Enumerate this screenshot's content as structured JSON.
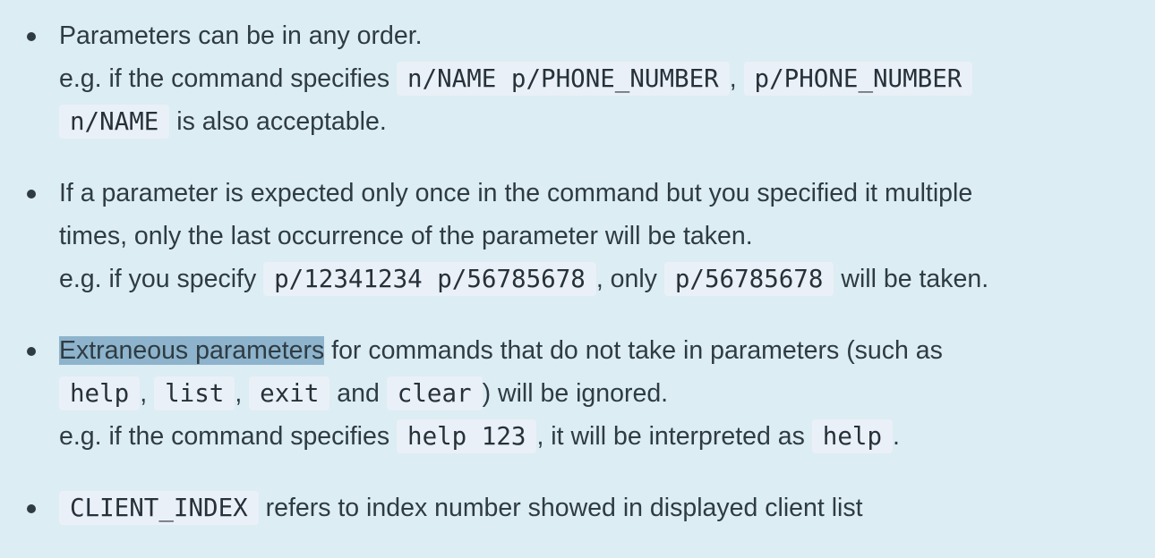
{
  "items": [
    {
      "l1": "Parameters can be in any order.",
      "l2_a": "e.g. if the command specifies ",
      "l2_code1": "n/NAME p/PHONE_NUMBER",
      "l2_b": ", ",
      "l2_code2": "p/PHONE_NUMBER",
      "l3_code": "n/NAME",
      "l3_b": " is also acceptable."
    },
    {
      "l1": "If a parameter is expected only once in the command but you specified it multiple",
      "l2": "times, only the last occurrence of the parameter will be taken.",
      "l3_a": "e.g. if you specify ",
      "l3_code1": "p/12341234 p/56785678",
      "l3_b": ", only ",
      "l3_code2": "p/56785678",
      "l3_c": " will be taken."
    },
    {
      "l1_hl": "Extraneous parameters",
      "l1_b": " for commands that do not take in parameters (such as",
      "l2_code1": "help",
      "l2_a": ", ",
      "l2_code2": "list",
      "l2_b": ", ",
      "l2_code3": "exit",
      "l2_c": " and ",
      "l2_code4": "clear",
      "l2_d": ") will be ignored.",
      "l3_a": "e.g. if the command specifies ",
      "l3_code1": "help 123",
      "l3_b": ", it will be interpreted as ",
      "l3_code2": "help",
      "l3_c": "."
    },
    {
      "l1_code": "CLIENT_INDEX",
      "l1_b": " refers to index number showed in displayed client list"
    }
  ]
}
